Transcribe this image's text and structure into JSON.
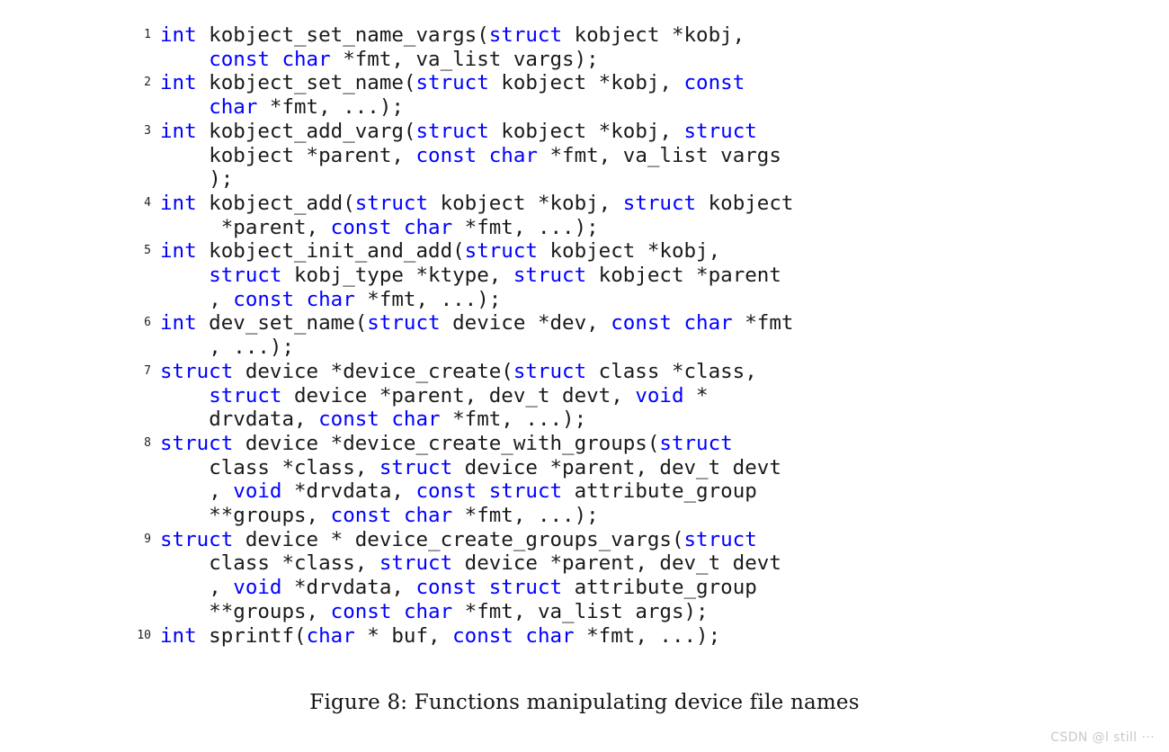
{
  "figure": {
    "caption": "Figure 8: Functions manipulating device file names",
    "keyword_color": "#0000ff",
    "text_color": "#1a1a1a",
    "background_color": "#ffffff",
    "lineno_color": "#222222"
  },
  "watermark": {
    "text": "CSDN @l still ···",
    "color": "#c9c9c9"
  },
  "listing": {
    "language": "c",
    "keywords": [
      "int",
      "struct",
      "const",
      "char",
      "void"
    ],
    "lines": [
      {
        "number": "1",
        "code": "int kobject_set_name_vargs(struct kobject *kobj,\n    const char *fmt, va_list vargs);",
        "tokens": [
          {
            "t": "int",
            "k": true
          },
          {
            "t": " kobject_set_name_vargs(",
            "k": false
          },
          {
            "t": "struct",
            "k": true
          },
          {
            "t": " kobject *kobj,\n    ",
            "k": false
          },
          {
            "t": "const",
            "k": true
          },
          {
            "t": " ",
            "k": false
          },
          {
            "t": "char",
            "k": true
          },
          {
            "t": " *fmt, va_list vargs);",
            "k": false
          }
        ]
      },
      {
        "number": "2",
        "code": "int kobject_set_name(struct kobject *kobj, const\n    char *fmt, ...);",
        "tokens": [
          {
            "t": "int",
            "k": true
          },
          {
            "t": " kobject_set_name(",
            "k": false
          },
          {
            "t": "struct",
            "k": true
          },
          {
            "t": " kobject *kobj, ",
            "k": false
          },
          {
            "t": "const",
            "k": true
          },
          {
            "t": "\n    ",
            "k": false
          },
          {
            "t": "char",
            "k": true
          },
          {
            "t": " *fmt, ...);",
            "k": false
          }
        ]
      },
      {
        "number": "3",
        "code": "int kobject_add_varg(struct kobject *kobj, struct\n    kobject *parent, const char *fmt, va_list vargs\n    );",
        "tokens": [
          {
            "t": "int",
            "k": true
          },
          {
            "t": " kobject_add_varg(",
            "k": false
          },
          {
            "t": "struct",
            "k": true
          },
          {
            "t": " kobject *kobj, ",
            "k": false
          },
          {
            "t": "struct",
            "k": true
          },
          {
            "t": "\n    kobject *parent, ",
            "k": false
          },
          {
            "t": "const",
            "k": true
          },
          {
            "t": " ",
            "k": false
          },
          {
            "t": "char",
            "k": true
          },
          {
            "t": " *fmt, va_list vargs\n    );",
            "k": false
          }
        ]
      },
      {
        "number": "4",
        "code": "int kobject_add(struct kobject *kobj, struct kobject\n     *parent, const char *fmt, ...);",
        "tokens": [
          {
            "t": "int",
            "k": true
          },
          {
            "t": " kobject_add(",
            "k": false
          },
          {
            "t": "struct",
            "k": true
          },
          {
            "t": " kobject *kobj, ",
            "k": false
          },
          {
            "t": "struct",
            "k": true
          },
          {
            "t": " kobject\n     *parent, ",
            "k": false
          },
          {
            "t": "const",
            "k": true
          },
          {
            "t": " ",
            "k": false
          },
          {
            "t": "char",
            "k": true
          },
          {
            "t": " *fmt, ...);",
            "k": false
          }
        ]
      },
      {
        "number": "5",
        "code": "int kobject_init_and_add(struct kobject *kobj,\n    struct kobj_type *ktype, struct kobject *parent\n    , const char *fmt, ...);",
        "tokens": [
          {
            "t": "int",
            "k": true
          },
          {
            "t": " kobject_init_and_add(",
            "k": false
          },
          {
            "t": "struct",
            "k": true
          },
          {
            "t": " kobject *kobj,\n    ",
            "k": false
          },
          {
            "t": "struct",
            "k": true
          },
          {
            "t": " kobj_type *ktype, ",
            "k": false
          },
          {
            "t": "struct",
            "k": true
          },
          {
            "t": " kobject *parent\n    , ",
            "k": false
          },
          {
            "t": "const",
            "k": true
          },
          {
            "t": " ",
            "k": false
          },
          {
            "t": "char",
            "k": true
          },
          {
            "t": " *fmt, ...);",
            "k": false
          }
        ]
      },
      {
        "number": "6",
        "code": "int dev_set_name(struct device *dev, const char *fmt\n    , ...);",
        "tokens": [
          {
            "t": "int",
            "k": true
          },
          {
            "t": " dev_set_name(",
            "k": false
          },
          {
            "t": "struct",
            "k": true
          },
          {
            "t": " device *dev, ",
            "k": false
          },
          {
            "t": "const",
            "k": true
          },
          {
            "t": " ",
            "k": false
          },
          {
            "t": "char",
            "k": true
          },
          {
            "t": " *fmt\n    , ...);",
            "k": false
          }
        ]
      },
      {
        "number": "7",
        "code": "struct device *device_create(struct class *class,\n    struct device *parent, dev_t devt, void *\n    drvdata, const char *fmt, ...);",
        "tokens": [
          {
            "t": "struct",
            "k": true
          },
          {
            "t": " device *device_create(",
            "k": false
          },
          {
            "t": "struct",
            "k": true
          },
          {
            "t": " class *class,\n    ",
            "k": false
          },
          {
            "t": "struct",
            "k": true
          },
          {
            "t": " device *parent, dev_t devt, ",
            "k": false
          },
          {
            "t": "void",
            "k": true
          },
          {
            "t": " *\n    drvdata, ",
            "k": false
          },
          {
            "t": "const",
            "k": true
          },
          {
            "t": " ",
            "k": false
          },
          {
            "t": "char",
            "k": true
          },
          {
            "t": " *fmt, ...);",
            "k": false
          }
        ]
      },
      {
        "number": "8",
        "code": "struct device *device_create_with_groups(struct\n    class *class, struct device *parent, dev_t devt\n    , void *drvdata, const struct attribute_group\n    **groups, const char *fmt, ...);",
        "tokens": [
          {
            "t": "struct",
            "k": true
          },
          {
            "t": " device *device_create_with_groups(",
            "k": false
          },
          {
            "t": "struct",
            "k": true
          },
          {
            "t": "\n    class *class, ",
            "k": false
          },
          {
            "t": "struct",
            "k": true
          },
          {
            "t": " device *parent, dev_t devt\n    , ",
            "k": false
          },
          {
            "t": "void",
            "k": true
          },
          {
            "t": " *drvdata, ",
            "k": false
          },
          {
            "t": "const",
            "k": true
          },
          {
            "t": " ",
            "k": false
          },
          {
            "t": "struct",
            "k": true
          },
          {
            "t": " attribute_group\n    **groups, ",
            "k": false
          },
          {
            "t": "const",
            "k": true
          },
          {
            "t": " ",
            "k": false
          },
          {
            "t": "char",
            "k": true
          },
          {
            "t": " *fmt, ...);",
            "k": false
          }
        ]
      },
      {
        "number": "9",
        "code": "struct device * device_create_groups_vargs(struct\n    class *class, struct device *parent, dev_t devt\n    , void *drvdata, const struct attribute_group\n    **groups, const char *fmt, va_list args);",
        "tokens": [
          {
            "t": "struct",
            "k": true
          },
          {
            "t": " device * device_create_groups_vargs(",
            "k": false
          },
          {
            "t": "struct",
            "k": true
          },
          {
            "t": "\n    class *class, ",
            "k": false
          },
          {
            "t": "struct",
            "k": true
          },
          {
            "t": " device *parent, dev_t devt\n    , ",
            "k": false
          },
          {
            "t": "void",
            "k": true
          },
          {
            "t": " *drvdata, ",
            "k": false
          },
          {
            "t": "const",
            "k": true
          },
          {
            "t": " ",
            "k": false
          },
          {
            "t": "struct",
            "k": true
          },
          {
            "t": " attribute_group\n    **groups, ",
            "k": false
          },
          {
            "t": "const",
            "k": true
          },
          {
            "t": " ",
            "k": false
          },
          {
            "t": "char",
            "k": true
          },
          {
            "t": " *fmt, va_list args);",
            "k": false
          }
        ]
      },
      {
        "number": "10",
        "code": "int sprintf(char * buf, const char *fmt, ...);",
        "tokens": [
          {
            "t": "int",
            "k": true
          },
          {
            "t": " sprintf(",
            "k": false
          },
          {
            "t": "char",
            "k": true
          },
          {
            "t": " * buf, ",
            "k": false
          },
          {
            "t": "const",
            "k": true
          },
          {
            "t": " ",
            "k": false
          },
          {
            "t": "char",
            "k": true
          },
          {
            "t": " *fmt, ...);",
            "k": false
          }
        ]
      }
    ]
  }
}
